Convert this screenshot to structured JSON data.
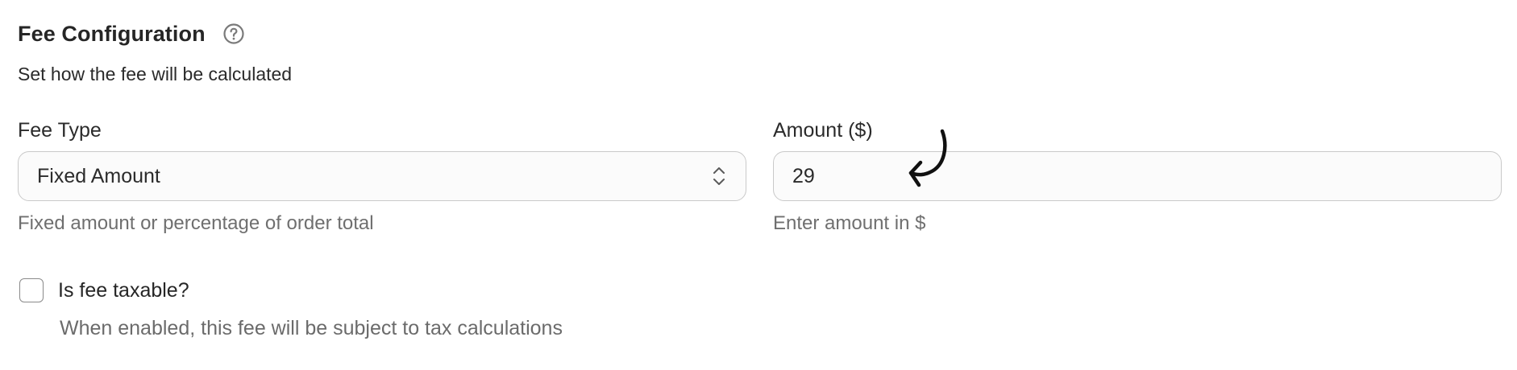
{
  "section": {
    "title": "Fee Configuration",
    "help_icon": "question-circle-icon",
    "subtitle": "Set how the fee will be calculated"
  },
  "fee_type": {
    "label": "Fee Type",
    "selected": "Fixed Amount",
    "chevron_icon": "chevron-up-down-icon",
    "hint": "Fixed amount or percentage of order total"
  },
  "amount": {
    "label": "Amount ($)",
    "value": "29",
    "hint": "Enter amount in $",
    "annotation_icon": "curved-arrow-icon"
  },
  "taxable": {
    "label": "Is fee taxable?",
    "checked": false,
    "description": "When enabled, this fee will be subject to tax calculations"
  },
  "colors": {
    "text_primary": "#262626",
    "text_muted": "#6f6f6f",
    "border": "#c9c9c9",
    "field_bg": "#fbfbfb"
  }
}
